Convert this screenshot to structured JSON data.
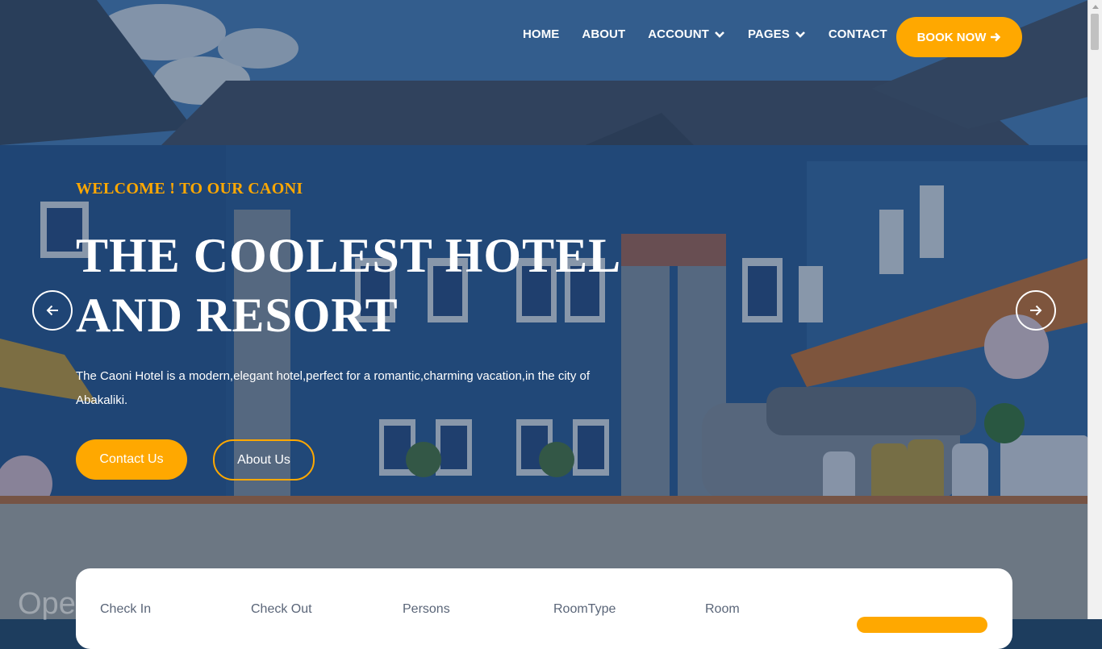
{
  "nav": {
    "items": [
      {
        "label": "HOME",
        "dropdown": false
      },
      {
        "label": "ABOUT",
        "dropdown": false
      },
      {
        "label": "ACCOUNT",
        "dropdown": true
      },
      {
        "label": "PAGES",
        "dropdown": true
      },
      {
        "label": "CONTACT",
        "dropdown": false
      }
    ],
    "book_label": "BOOK NOW"
  },
  "hero": {
    "welcome": "WELCOME ! TO OUR CAONI",
    "headline_line1": "THE COOLEST HOTEL",
    "headline_line2": "AND RESORT",
    "description": "The Caoni Hotel is a modern,elegant hotel,perfect for a romantic,charming vacation,in the city of Abakaliki.",
    "contact_label": "Contact Us",
    "about_label": "About Us",
    "watermark": "Ope"
  },
  "booking": {
    "fields": [
      "Check In",
      "Check Out",
      "Persons",
      "RoomType",
      "Room"
    ]
  },
  "icons": {
    "prev": "arrow-left-icon",
    "next": "arrow-right-icon",
    "book": "arrow-right-icon",
    "dropdown": "chevron-down-icon"
  },
  "colors": {
    "accent": "#ffa800",
    "overlay": "#122d50",
    "card": "#ffffff",
    "field_label": "#5a6578"
  }
}
